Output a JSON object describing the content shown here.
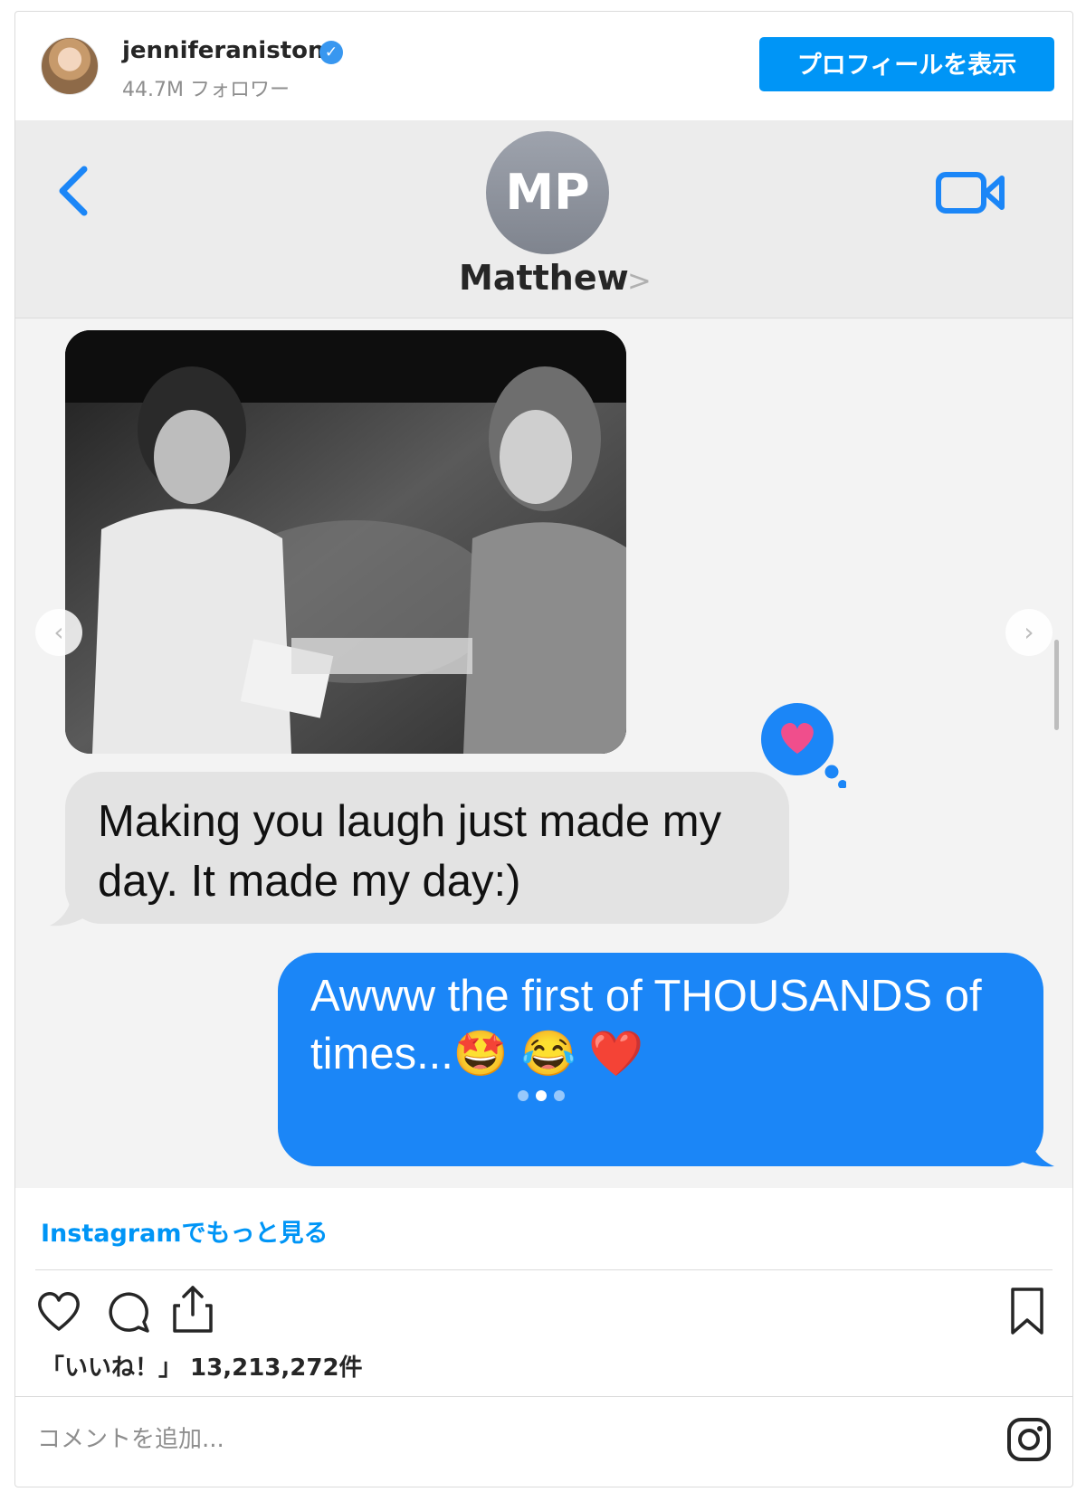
{
  "post_header": {
    "username": "jenniferaniston",
    "verified_icon": "verified-badge-icon",
    "followers": "44.7M フォロワー",
    "view_profile_label": "プロフィールを表示"
  },
  "media": {
    "messages_header": {
      "contact_initials": "MP",
      "contact_name": "Matthew",
      "contact_chevron": ">",
      "back_icon": "chevron-left-icon",
      "video_icon": "video-camera-icon"
    },
    "photo_alt": "black-and-white photo",
    "received_message": "Making you laugh just made my day. It made my day:)",
    "tapback_icon": "heart-tapback-icon",
    "sent_message": "Awww the first of THOUSANDS of times...🤩 😂 ❤️",
    "carousel": {
      "prev_symbol": "‹",
      "next_symbol": "›",
      "slide_count": 3,
      "active_slide": 2
    }
  },
  "more_link": "Instagramでもっと見る",
  "actions": {
    "like_icon": "heart-icon",
    "comment_icon": "comment-icon",
    "share_icon": "share-icon",
    "save_icon": "bookmark-icon"
  },
  "likes_label": "「いいね！」 13,213,272件",
  "comment_placeholder": "コメントを追加...",
  "instagram_icon": "instagram-logo-icon",
  "colors": {
    "accent": "#0095f6",
    "sent_bubble": "#1b86f7",
    "received_bubble": "#e3e3e3",
    "tapback": "#1b86f7",
    "heart": "#f04e8c"
  }
}
